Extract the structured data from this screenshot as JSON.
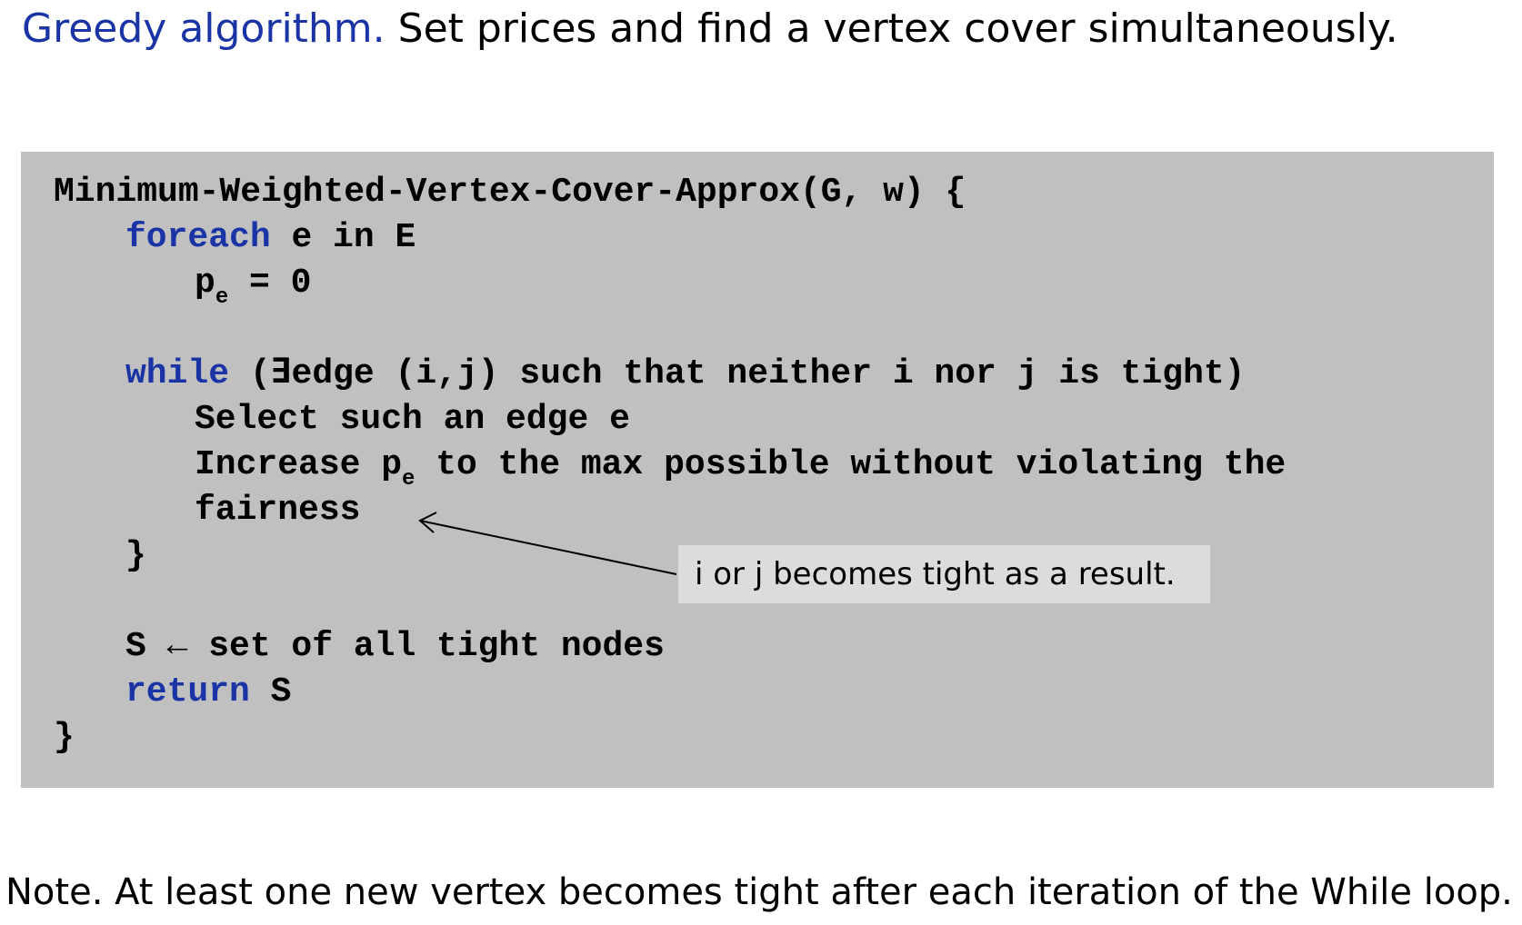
{
  "header": {
    "accent": "Greedy algorithm.",
    "rest": " Set prices and find a vertex cover simultaneously."
  },
  "code": {
    "signature": "Minimum-Weighted-Vertex-Cover-Approx(G, w) {",
    "foreach_kw": "foreach",
    "foreach_rest": " e in E",
    "pe_p": "p",
    "pe_sub": "e",
    "pe_rest": " = 0",
    "while_kw": "while",
    "while_rest": " (∃edge (i,j) such that neither i nor j is tight)",
    "select_line": "Select such an edge e",
    "increase_pre": "Increase p",
    "increase_sub": "e",
    "increase_rest": " to the max possible without violating the",
    "fairness": "fairness",
    "close_inner": "}",
    "set_line": "S ← set of all tight nodes",
    "return_kw": "return",
    "return_rest": " S",
    "close_outer": "}"
  },
  "callout": {
    "text": "i or j becomes tight as a result."
  },
  "note": {
    "text": "Note. At least one new vertex becomes tight after each iteration of the While loop."
  },
  "colors": {
    "accent": "#1a34a6",
    "code_background": "#c0c0c0",
    "callout_background": "#dcdcdc"
  }
}
